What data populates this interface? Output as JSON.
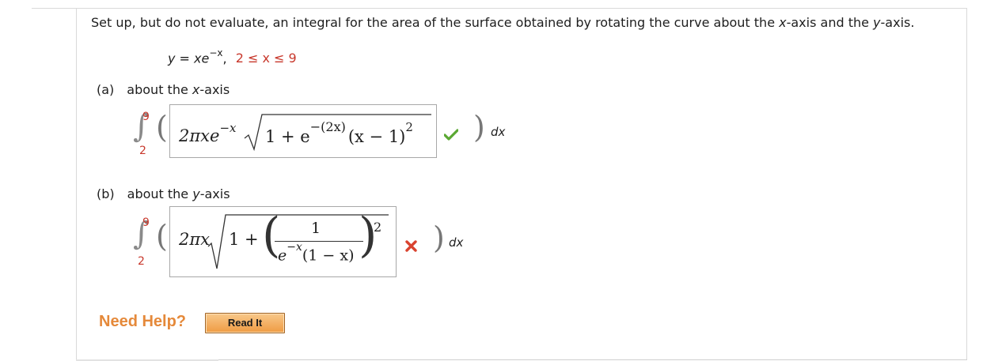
{
  "question": {
    "prompt_before_x": "Set up, but do not evaluate, an integral for the area of the surface obtained by rotating the curve about the ",
    "x_var": "x",
    "prompt_mid": "-axis and the ",
    "y_var": "y",
    "prompt_end": "-axis.",
    "curve_lhs": "y = xe",
    "curve_exp": "−x",
    "curve_comma": ",",
    "curve_range": "2 ≤ x ≤ 9"
  },
  "part_a": {
    "label": "(a)",
    "about_prefix": "about the ",
    "axis_var": "x",
    "about_suffix": "-axis",
    "upper_limit": "9",
    "lower_limit": "2",
    "answer": {
      "coef": "2πxe",
      "coef_exp": "−x",
      "one_plus": "1 + e",
      "inner_exp": "−(2x)",
      "factor": "(x − 1)",
      "power": "2"
    },
    "status": "correct",
    "differential": "dx"
  },
  "part_b": {
    "label": "(b)",
    "about_prefix": "about the ",
    "axis_var": "y",
    "about_suffix": "-axis",
    "upper_limit": "9",
    "lower_limit": "2",
    "answer": {
      "coef": "2πx",
      "one_plus": "1 +",
      "numerator": "1",
      "den_base": "e",
      "den_exp": "−x",
      "den_rest": "(1 − x)",
      "power": "2"
    },
    "status": "incorrect",
    "differential": "dx"
  },
  "help": {
    "need_help": "Need Help?",
    "read_it": "Read It"
  },
  "colors": {
    "limit_red": "#c8382c",
    "check_green": "#5aa832",
    "cross_red": "#d9432f",
    "help_orange": "#e5893a",
    "button_orange": "#ef9b42"
  },
  "icons": {
    "correct": "check-icon",
    "incorrect": "cross-icon"
  }
}
